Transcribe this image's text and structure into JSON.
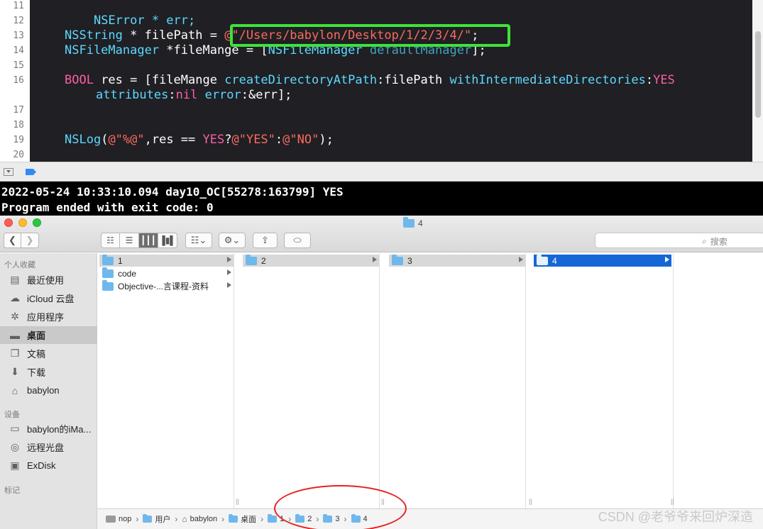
{
  "editor": {
    "line_numbers": [
      "11",
      "12",
      "13",
      "14",
      "15",
      "16",
      "17",
      "18",
      "19",
      "20"
    ],
    "lines": {
      "l11": "NSError * err;",
      "l13_type": "NSString",
      "l13_mid": " * filePath = ",
      "l13_str": "@\"/Users/babylon/Desktop/1/2/3/4/\"",
      "l13_end": ";",
      "l14_type": "NSFileManager",
      "l14_mid": " *fileMange = [",
      "l14_type2": "NSFileManager",
      "l14_sp": " ",
      "l14_meth": "defaultManager",
      "l14_end": "];",
      "l16_kw": "BOOL",
      "l16_mid": " res = [fileMange ",
      "l16_meth": "createDirectoryAtPath",
      "l16_arg": ":filePath ",
      "l16_meth2": "withIntermediateDirectories",
      "l16_colon": ":",
      "l16_yes": "YES",
      "l16b_meth": "attributes",
      "l16b_colon": ":",
      "l16b_nil": "nil",
      "l16b_sp": " ",
      "l16b_meth2": "error",
      "l16b_end": ":&err];",
      "l19_meth": "NSLog",
      "l19_p": "(",
      "l19_str": "@\"%@\"",
      "l19_mid": ",res == ",
      "l19_yes": "YES",
      "l19_q": "?",
      "l19_str2": "@\"YES\"",
      "l19_colon": ":",
      "l19_str3": "@\"NO\"",
      "l19_end": ");"
    }
  },
  "console": {
    "line1": "2022-05-24 10:33:10.094 day10_OC[55278:163799] YES",
    "line2": "Program ended with exit code: 0"
  },
  "finder": {
    "window_title": "4",
    "search_placeholder": "搜索",
    "sidebar": {
      "favorites_header": "个人收藏",
      "devices_header": "设备",
      "tags_header": "标记",
      "favorites": [
        {
          "label": "最近使用",
          "icon": "clock-icon"
        },
        {
          "label": "iCloud 云盘",
          "icon": "cloud-icon"
        },
        {
          "label": "应用程序",
          "icon": "apps-icon"
        },
        {
          "label": "桌面",
          "icon": "desktop-icon"
        },
        {
          "label": "文稿",
          "icon": "document-icon"
        },
        {
          "label": "下载",
          "icon": "download-icon"
        },
        {
          "label": "babylon",
          "icon": "home-icon"
        }
      ],
      "devices": [
        {
          "label": "babylon的iMa...",
          "icon": "computer-icon"
        },
        {
          "label": "远程光盘",
          "icon": "disc-icon"
        },
        {
          "label": "ExDisk",
          "icon": "disk-icon"
        }
      ]
    },
    "columns": [
      {
        "items": [
          "1",
          "code",
          "Objective-...言课程-资料"
        ]
      },
      {
        "items": [
          "2"
        ]
      },
      {
        "items": [
          "3"
        ]
      },
      {
        "items": [
          "4"
        ]
      }
    ],
    "pathbar": [
      "nop",
      "用户",
      "babylon",
      "桌面",
      "1",
      "2",
      "3",
      "4"
    ]
  },
  "watermark": "CSDN @老爷爷来回炉深造",
  "colors": {
    "editor_bg": "#1f1f24",
    "highlight_box": "#3ee33a",
    "selection_blue": "#1667d6",
    "annotation_red": "#e82121"
  }
}
